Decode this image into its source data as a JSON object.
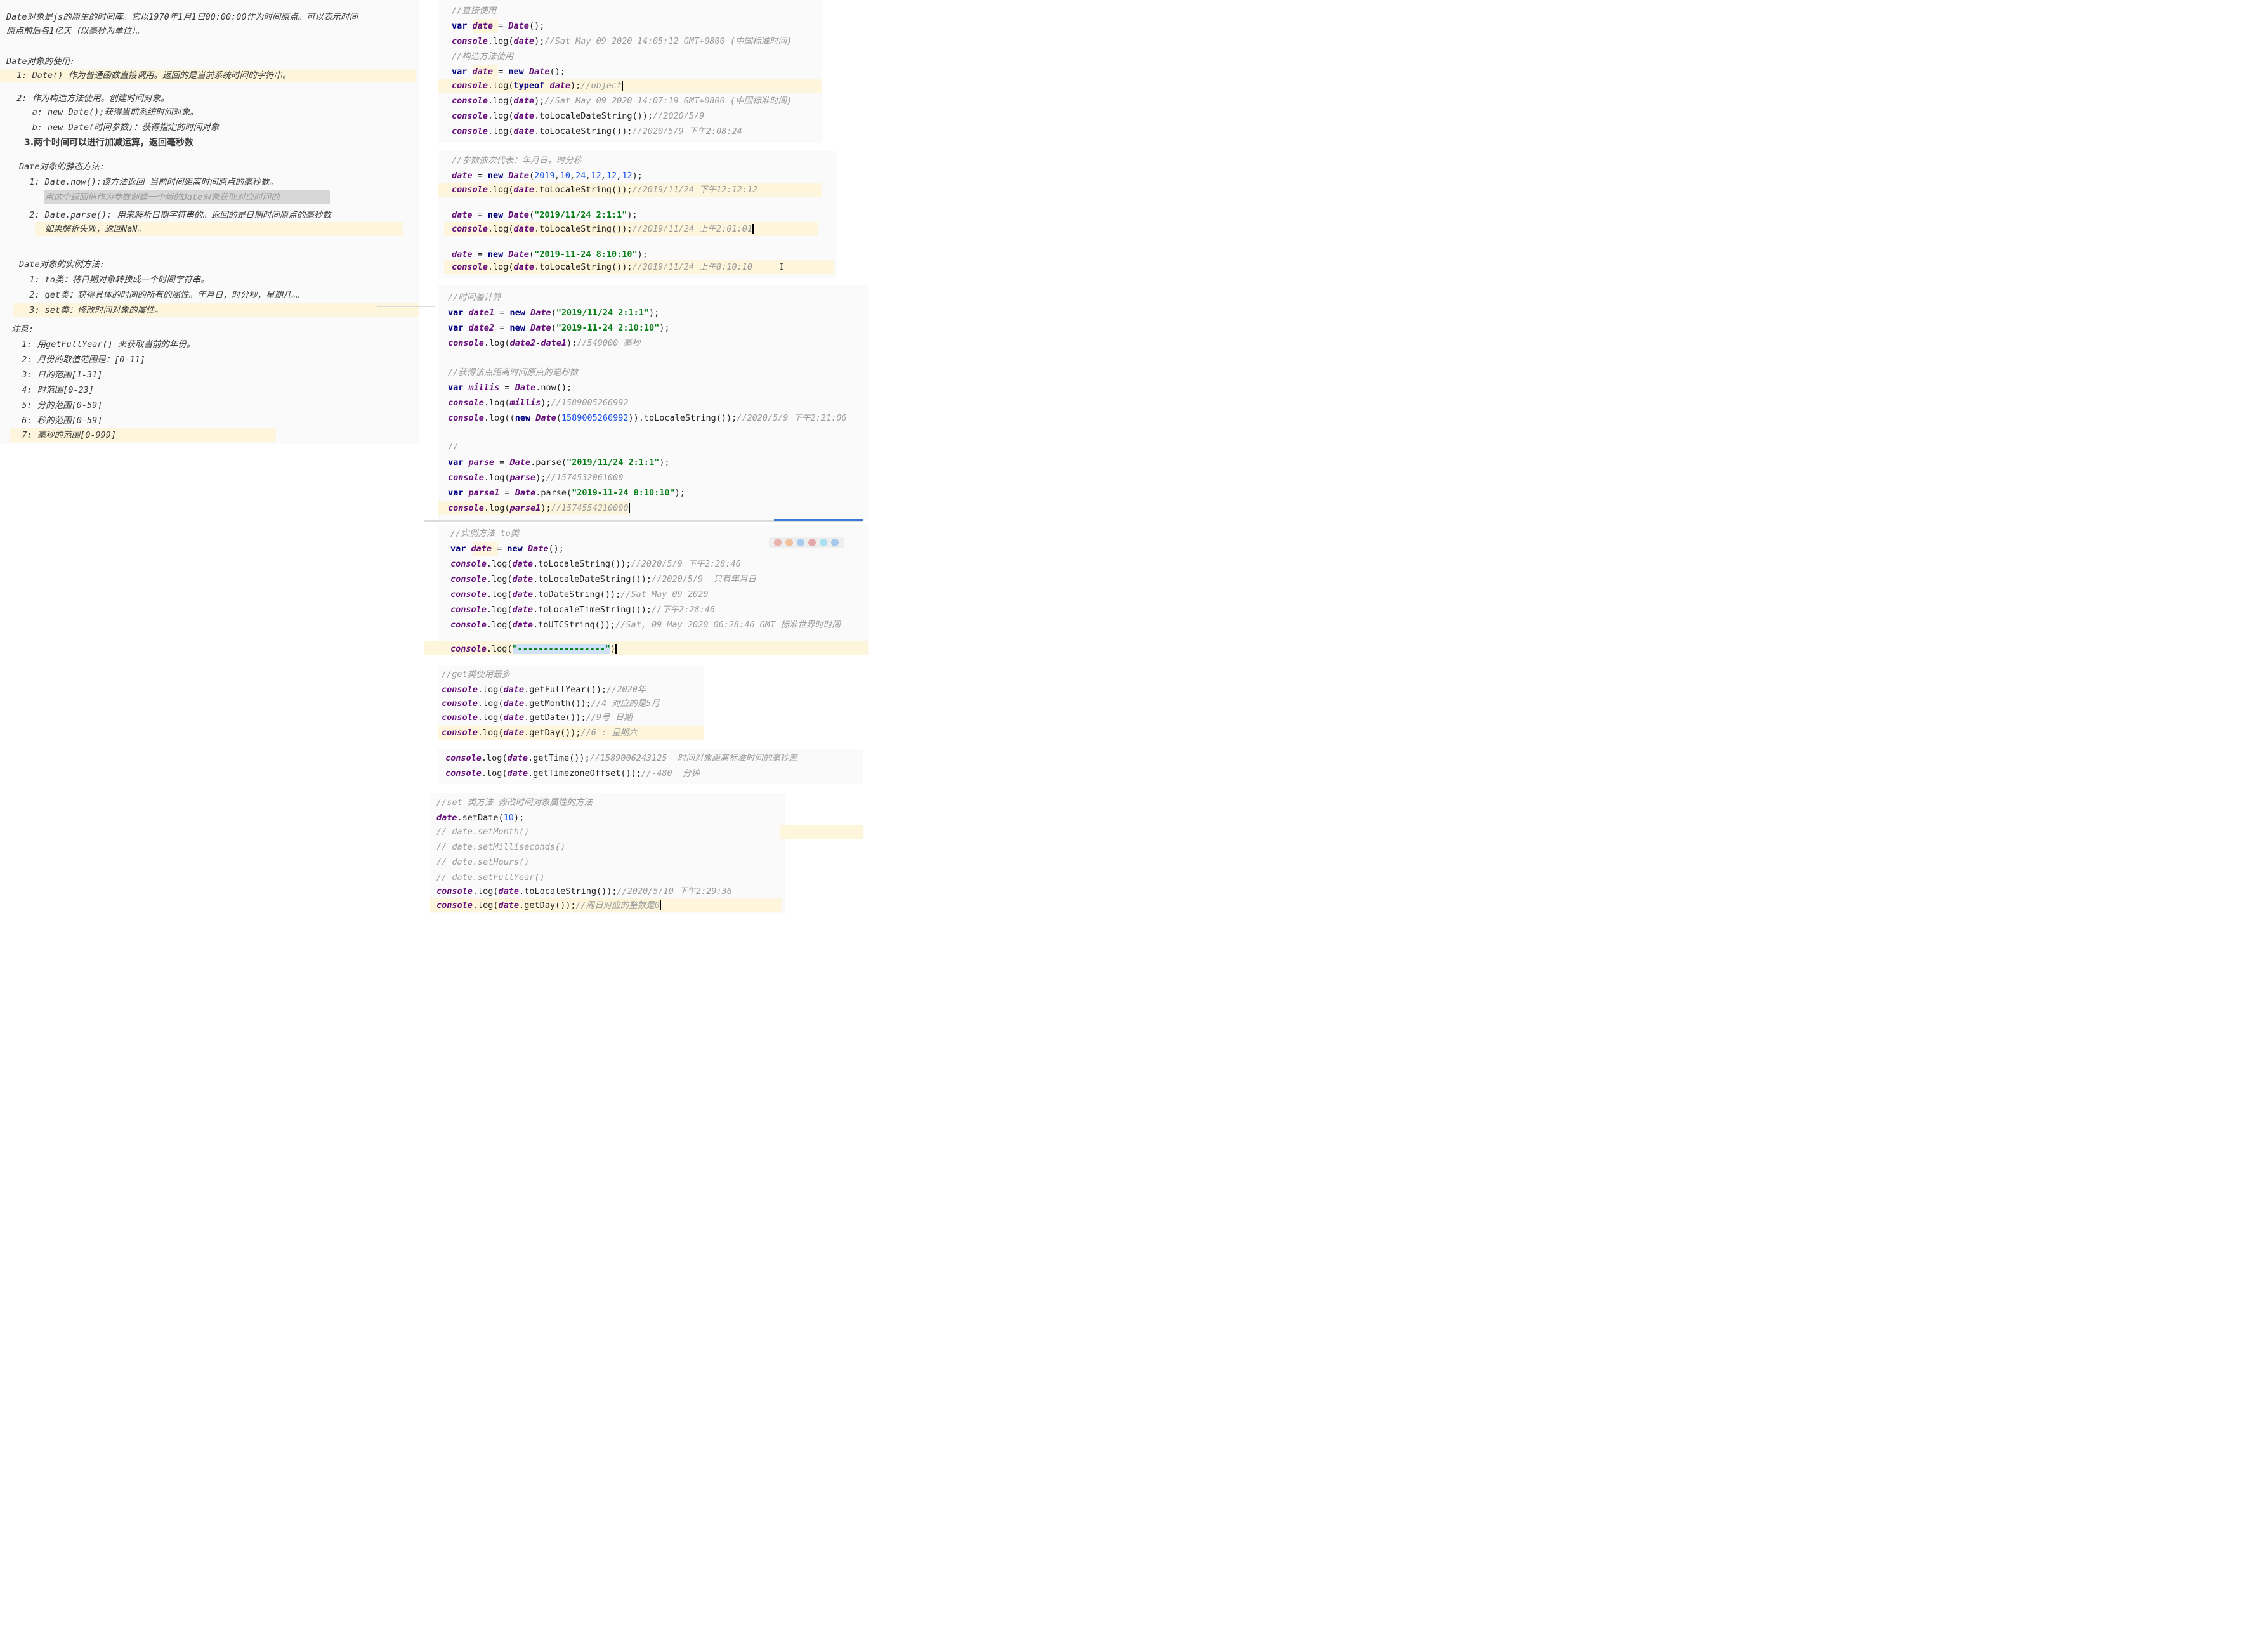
{
  "notes": {
    "lines": [
      "Date对象是js的原生的时间库。它以1970年1月1日00:00:00作为时间原点。可以表示时间",
      "原点前后各1亿天（以毫秒为单位）。",
      "",
      "Date对象的使用:",
      "  1: Date() 作为普通函数直接调用。返回的是当前系统时间的字符串。",
      "",
      "  2: 作为构造方法使用。创建时间对象。",
      "     a: new Date();获得当前系统时间对象。",
      "     b: new Date(时间参数)：获得指定的时间对象",
      "3.两个时间可以进行加减运算，返回毫秒数",
      "",
      "Date对象的静态方法:",
      "  1: Date.now():该方法返回 当前时间距离时间原点的毫秒数。",
      "     用这个返回值作为参数创建一个新的Date对象获取对应时间的",
      "  2: Date.parse(): 用来解析日期字符串的。返回的是日期时间原点的毫秒数",
      "     如果解析失败，返回NaN。",
      "",
      "Date对象的实例方法:",
      "  1: to类：将日期对象转换成一个时间字符串。",
      "  2: get类：获得具体的时间的所有的属性。年月日，时分秒，星期几。。",
      "  3: set类：修改时间对象的属性。",
      "注意:",
      "  1: 用getFullYear() 来获取当前的年份。",
      "  2: 月份的取值范围是：[0-11]",
      "  3: 日的范围[1-31]",
      "  4: 时范围[0-23]",
      "  5: 分的范围[0-59]",
      "  6: 秒的范围[0-59]",
      "  7: 毫秒的范围[0-999]"
    ]
  },
  "code": {
    "c1": "//直接使用",
    "c2": "//Sat May 09 2020 14:05:12 GMT+0800 (中国标准时间)",
    "c3": "//构造方法使用",
    "c4": "//object",
    "c5": "//Sat May 09 2020 14:07:19 GMT+0800 (中国标准时间)",
    "c6": "//2020/5/9",
    "c7": "//2020/5/9 下午2:08:24",
    "c8": "//参数依次代表：年月日，时分秒",
    "c9": "//2019/11/24 下午12:12:12",
    "c10": "//2019/11/24 上午2:01:01",
    "c11": "//2019/11/24 上午8:10:10",
    "c12": "//时间差计算",
    "c13": "//549000 毫秒",
    "c14": "//获得该点距离时间原点的毫秒数",
    "c15": "//1589005266992",
    "c16": "//2020/5/9 下午2:21:06",
    "c17": "//",
    "c18": "//1574532061000",
    "c19": "//1574554210000",
    "c20": "//实例方法 to类",
    "c21": "//2020/5/9 下午2:28:46",
    "c22": "//2020/5/9  只有年月日",
    "c23": "//Sat May 09 2020",
    "c24": "//下午2:28:46",
    "c25": "//Sat, 09 May 2020 06:28:46 GMT 标准世界时时间",
    "c26": "//get类使用最多",
    "c27": "//2020年",
    "c28": "//4 对应的是5月",
    "c29": "//9号 日期",
    "c30": "//6 : 星期六",
    "c31": "//1589006243125  时间对象距离标准时间的毫秒差",
    "c32": "//-480  分钟",
    "c33": "//set 类方法 修改时间对象属性的方法",
    "c34": "// date.setMonth()",
    "c35": "// date.setMilliseconds()",
    "c36": "// date.setHours()",
    "c37": "// date.setFullYear()",
    "c38": "//2020/5/10 下午2:29:36",
    "c39": "//周日对应的整数是0",
    "s1": "\"2019/11/24 2:1:1\"",
    "s2": "\"2019-11-24 8:10:10\"",
    "s3": "\"2019/11/24 2:1:1\"",
    "s4": "\"2019-11-24 2:10:10\"",
    "s5": "\"2019/11/24 2:1:1\"",
    "s6": "\"2019-11-24 8:10:10\"",
    "s7": "\"-----------------\""
  },
  "colors": {
    "highlight": "#fdf6dc",
    "panel": "#fafafa",
    "comment": "#9a9a9a",
    "keyword": "#000080",
    "variable": "#660e7a",
    "string": "#067d17",
    "number": "#1750eb"
  },
  "toolbar_icons": [
    "chrome-icon",
    "firefox-icon",
    "safari-icon",
    "opera-icon",
    "ie-icon",
    "edge-icon"
  ]
}
